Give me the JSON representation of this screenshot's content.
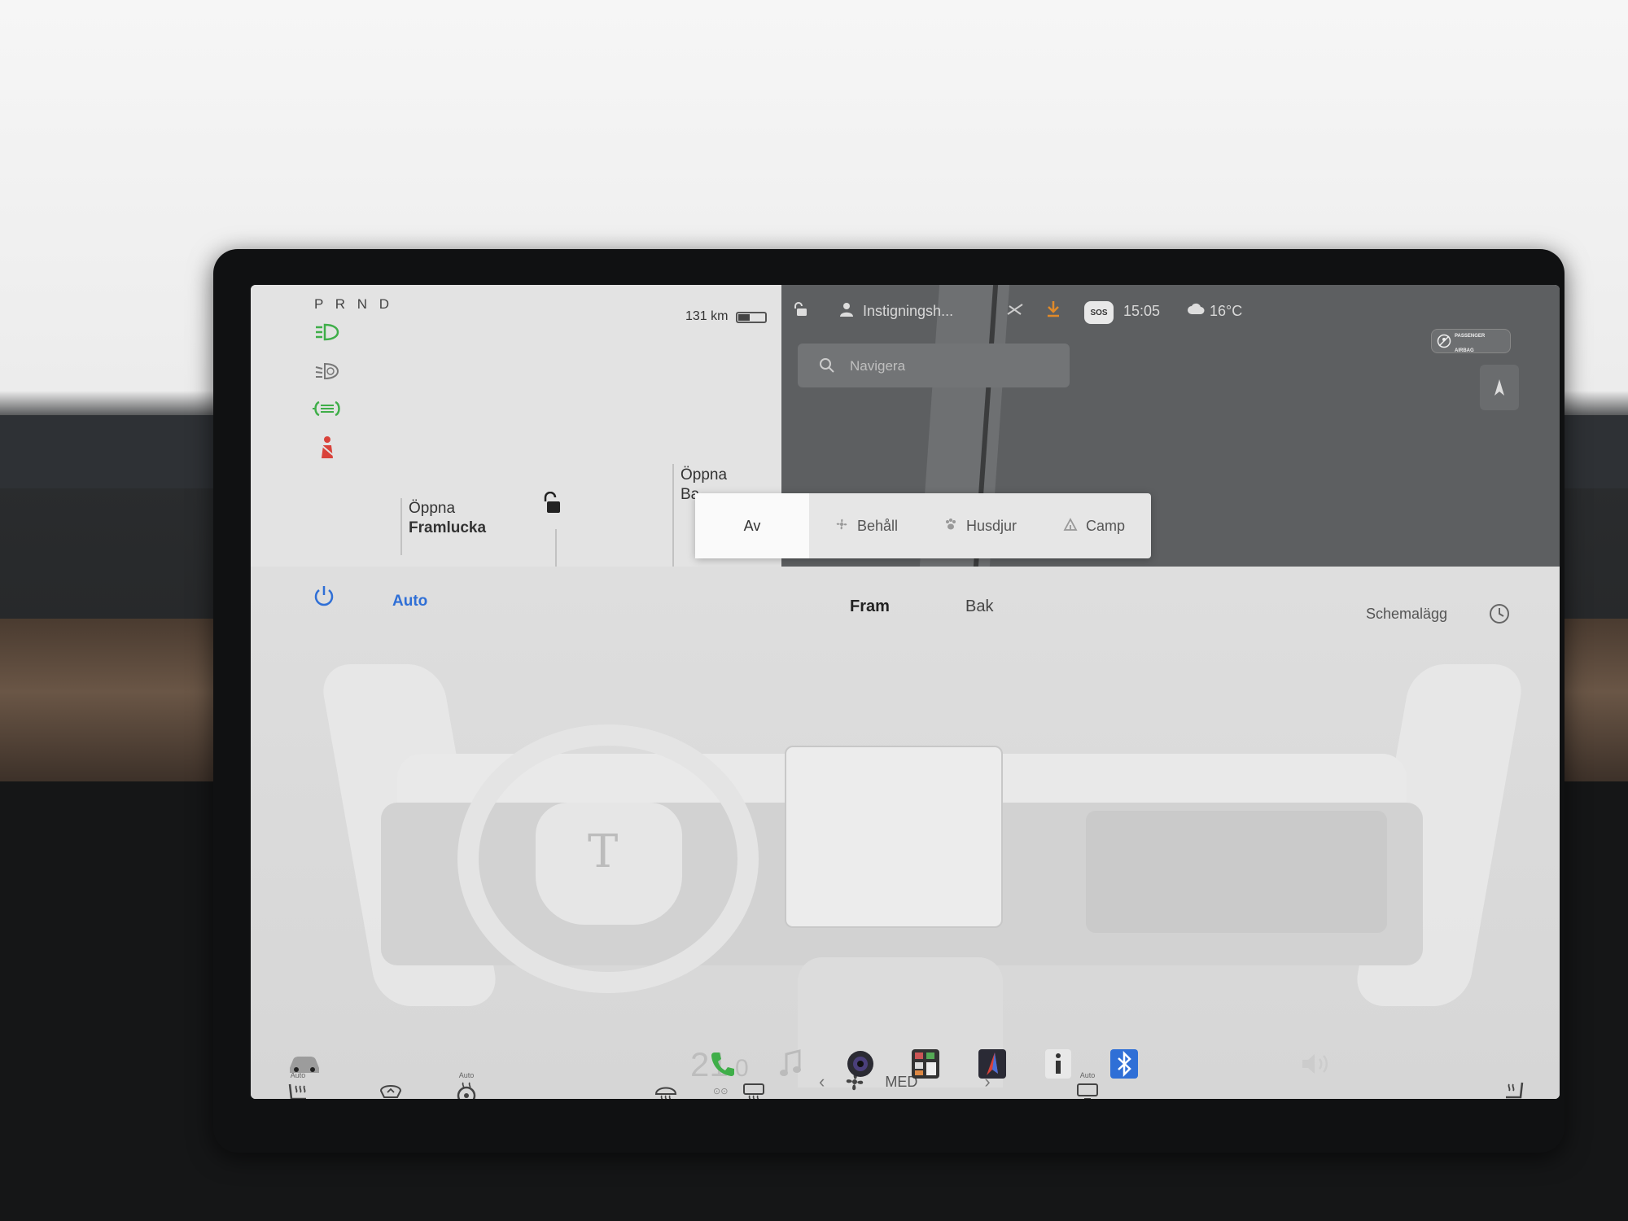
{
  "car": {
    "gear_selector": "P R N D",
    "range": "131 km",
    "front_trunk": {
      "line1": "Öppna",
      "line2": "Framlucka"
    },
    "rear_trunk": {
      "line1": "Öppna",
      "line2": "Ba"
    },
    "status_icons": [
      "headlights-icon",
      "parking-lights-icon",
      "fog-lights-icon",
      "seatbelt-warning-icon"
    ],
    "colors": {
      "green": "#3fae49",
      "red": "#d9423a"
    }
  },
  "topbar": {
    "profile": "Instigningsh...",
    "time": "15:05",
    "weather": "16°C",
    "sos": "SOS",
    "airbag": {
      "line1": "PASSENGER",
      "line2": "AIRBAG"
    }
  },
  "search": {
    "placeholder": "Navigera"
  },
  "modes": [
    {
      "label": "Av",
      "active": true
    },
    {
      "label": "Behåll",
      "active": false
    },
    {
      "label": "Husdjur",
      "active": false
    },
    {
      "label": "Camp",
      "active": false
    }
  ],
  "climate": {
    "auto": "Auto",
    "tab_front": "Fram",
    "tab_rear": "Bak",
    "schedule": "Schemalägg",
    "seat_heat_left_mode": "Auto",
    "wheel_heat_mode": "Auto",
    "rear_defrost_mode": "Auto",
    "fan_level": "MED",
    "accent": "#2f6fd6"
  },
  "dock": {
    "temperature_int": "21",
    "temperature_dec": ".0"
  }
}
